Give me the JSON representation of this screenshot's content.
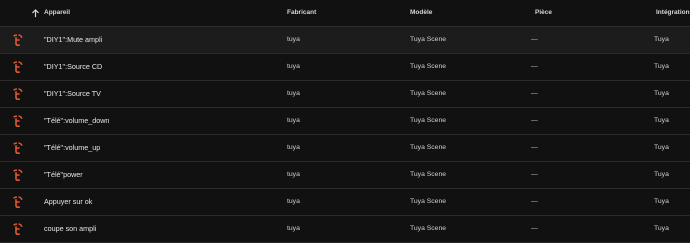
{
  "colors": {
    "background": "#111111",
    "tuya_icon": "#e2582d",
    "divider": "#2b2b2b"
  },
  "header": {
    "sort_icon": "arrow-up-icon",
    "columns": [
      "Appareil",
      "Fabricant",
      "Modèle",
      "Pièce",
      "Intégration"
    ]
  },
  "rows": [
    {
      "icon": "tuya-icon",
      "name": "\"DIY1\":Mute ampli",
      "manufacturer": "tuya",
      "model": "Tuya Scene",
      "room": "—",
      "integration": "Tuya"
    },
    {
      "icon": "tuya-icon",
      "name": "\"DIY1\":Source CD",
      "manufacturer": "tuya",
      "model": "Tuya Scene",
      "room": "—",
      "integration": "Tuya"
    },
    {
      "icon": "tuya-icon",
      "name": "\"DIY1\":Source TV",
      "manufacturer": "tuya",
      "model": "Tuya Scene",
      "room": "—",
      "integration": "Tuya"
    },
    {
      "icon": "tuya-icon",
      "name": "\"Télé\":volume_down",
      "manufacturer": "tuya",
      "model": "Tuya Scene",
      "room": "—",
      "integration": "Tuya"
    },
    {
      "icon": "tuya-icon",
      "name": "\"Télé\":volume_up",
      "manufacturer": "tuya",
      "model": "Tuya Scene",
      "room": "—",
      "integration": "Tuya"
    },
    {
      "icon": "tuya-icon",
      "name": "\"Télé\"power",
      "manufacturer": "tuya",
      "model": "Tuya Scene",
      "room": "—",
      "integration": "Tuya"
    },
    {
      "icon": "tuya-icon",
      "name": "Appuyer sur ok",
      "manufacturer": "tuya",
      "model": "Tuya Scene",
      "room": "—",
      "integration": "Tuya"
    },
    {
      "icon": "tuya-icon",
      "name": "coupe son ampli",
      "manufacturer": "tuya",
      "model": "Tuya Scene",
      "room": "—",
      "integration": "Tuya"
    }
  ]
}
